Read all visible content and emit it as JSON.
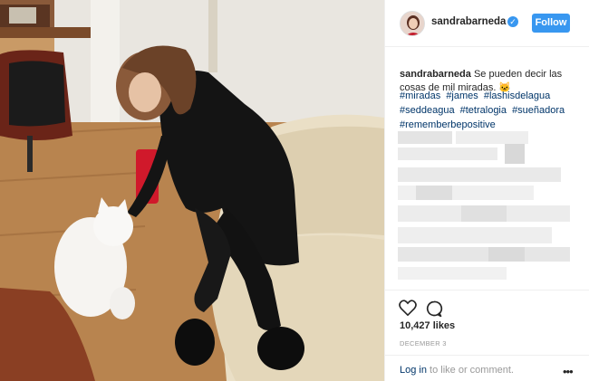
{
  "header": {
    "username": "sandrabarneda",
    "verified_icon": "verified-badge-icon",
    "follow_label": "Follow",
    "accent_color": "#3897f0"
  },
  "caption": {
    "username": "sandrabarneda",
    "text": "Se pueden decir las cosas de mil miradas. 🐱",
    "hashtags": [
      "#miradas",
      "#james",
      "#lashisdelagua",
      "#seddeagua",
      "#tetralogia",
      "#sueñadora",
      "#rememberbepositive"
    ]
  },
  "actions": {
    "like_icon": "heart-icon",
    "comment_icon": "comment-bubble-icon",
    "likes": "10,427 likes",
    "date": "DECEMBER 3"
  },
  "comment_box": {
    "login_link": "Log in",
    "login_rest": "to like or comment.",
    "more_icon": "more-options-icon",
    "more_glyph": "•••"
  }
}
